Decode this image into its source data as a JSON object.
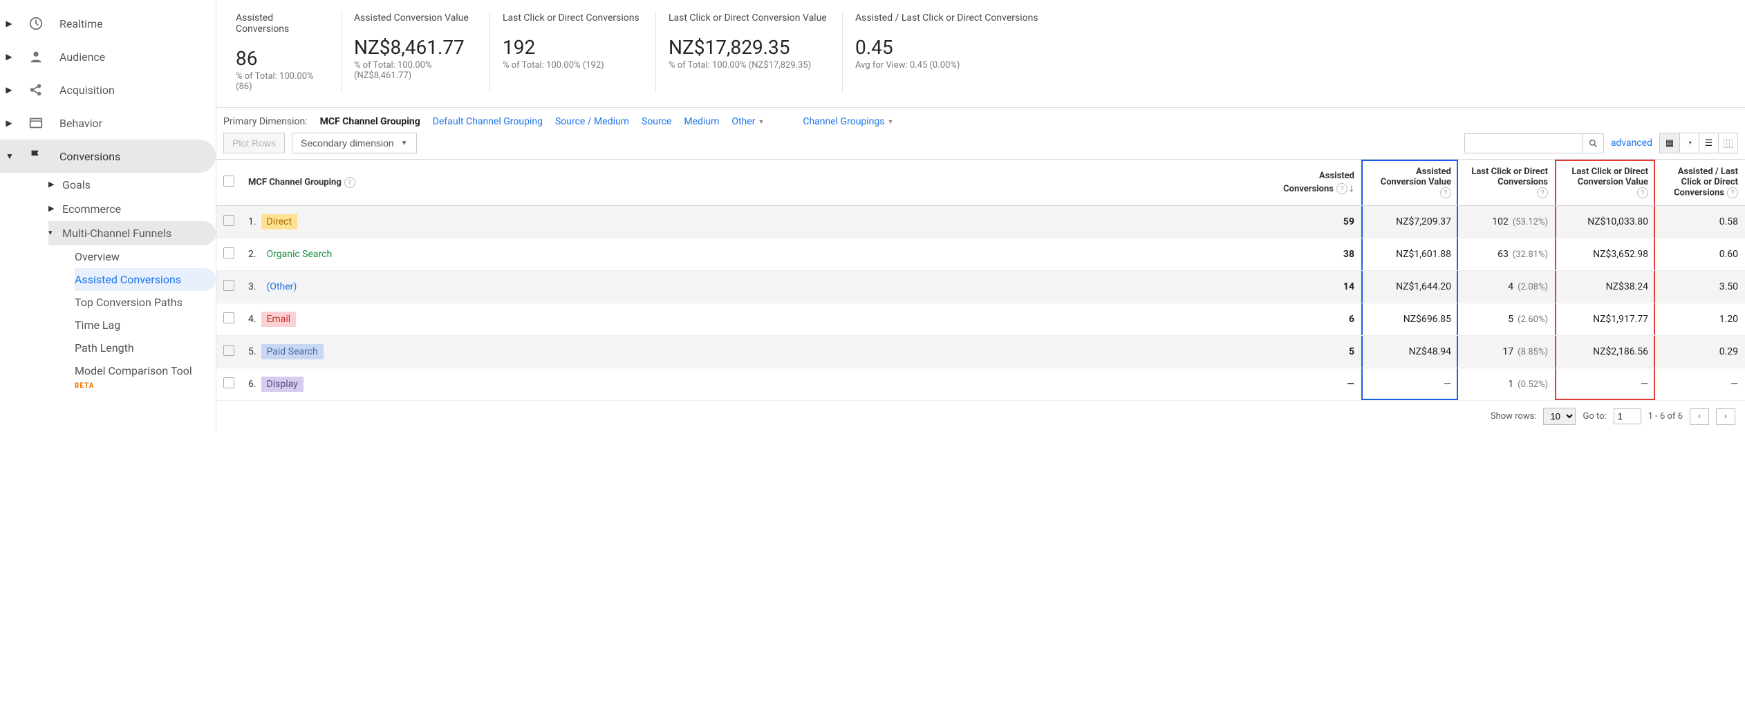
{
  "sidebar": {
    "items": [
      {
        "label": "Realtime"
      },
      {
        "label": "Audience"
      },
      {
        "label": "Acquisition"
      },
      {
        "label": "Behavior"
      },
      {
        "label": "Conversions"
      }
    ],
    "conv_sub": [
      {
        "label": "Goals"
      },
      {
        "label": "Ecommerce"
      },
      {
        "label": "Multi-Channel Funnels"
      }
    ],
    "mcf_sub": [
      {
        "label": "Overview"
      },
      {
        "label": "Assisted Conversions"
      },
      {
        "label": "Top Conversion Paths"
      },
      {
        "label": "Time Lag"
      },
      {
        "label": "Path Length"
      },
      {
        "label": "Model Comparison Tool"
      }
    ],
    "beta_label": "BETA"
  },
  "scorecards": [
    {
      "title": "Assisted Conversions",
      "value": "86",
      "sub": "% of Total: 100.00% (86)"
    },
    {
      "title": "Assisted Conversion Value",
      "value": "NZ$8,461.77",
      "sub": "% of Total: 100.00% (NZ$8,461.77)"
    },
    {
      "title": "Last Click or Direct Conversions",
      "value": "192",
      "sub": "% of Total: 100.00% (192)"
    },
    {
      "title": "Last Click or Direct Conversion Value",
      "value": "NZ$17,829.35",
      "sub": "% of Total: 100.00% (NZ$17,829.35)"
    },
    {
      "title": "Assisted / Last Click or Direct Conversions",
      "value": "0.45",
      "sub": "Avg for View: 0.45 (0.00%)"
    }
  ],
  "dimbar": {
    "label": "Primary Dimension:",
    "selected": "MCF Channel Grouping",
    "links": [
      "Default Channel Grouping",
      "Source / Medium",
      "Source",
      "Medium"
    ],
    "other": "Other",
    "channel_groupings": "Channel Groupings"
  },
  "toolbar": {
    "plot_rows": "Plot Rows",
    "secondary": "Secondary dimension",
    "advanced": "advanced"
  },
  "columns": [
    "MCF Channel Grouping",
    "Assisted Conversions",
    "Assisted Conversion Value",
    "Last Click or Direct Conversions",
    "Last Click or Direct Conversion Value",
    "Assisted / Last Click or Direct Conversions"
  ],
  "rows": [
    {
      "idx": "1.",
      "name": "Direct",
      "chip": "direct",
      "ac": "59",
      "acv": "NZ$7,209.37",
      "lc": "102",
      "lcp": "(53.12%)",
      "lcv": "NZ$10,033.80",
      "ratio": "0.58"
    },
    {
      "idx": "2.",
      "name": "Organic Search",
      "chip": "organic",
      "ac": "38",
      "acv": "NZ$1,601.88",
      "lc": "63",
      "lcp": "(32.81%)",
      "lcv": "NZ$3,652.98",
      "ratio": "0.60"
    },
    {
      "idx": "3.",
      "name": "(Other)",
      "chip": "other",
      "ac": "14",
      "acv": "NZ$1,644.20",
      "lc": "4",
      "lcp": "(2.08%)",
      "lcv": "NZ$38.24",
      "ratio": "3.50"
    },
    {
      "idx": "4.",
      "name": "Email",
      "chip": "email",
      "ac": "6",
      "acv": "NZ$696.85",
      "lc": "5",
      "lcp": "(2.60%)",
      "lcv": "NZ$1,917.77",
      "ratio": "1.20"
    },
    {
      "idx": "5.",
      "name": "Paid Search",
      "chip": "paid",
      "ac": "5",
      "acv": "NZ$48.94",
      "lc": "17",
      "lcp": "(8.85%)",
      "lcv": "NZ$2,186.56",
      "ratio": "0.29"
    },
    {
      "idx": "6.",
      "name": "Display",
      "chip": "display",
      "ac": "—",
      "acv": "—",
      "lc": "1",
      "lcp": "(0.52%)",
      "lcv": "—",
      "ratio": "—"
    }
  ],
  "pager": {
    "show_rows": "Show rows:",
    "rows_value": "10",
    "goto": "Go to:",
    "goto_value": "1",
    "range": "1 - 6 of 6"
  }
}
